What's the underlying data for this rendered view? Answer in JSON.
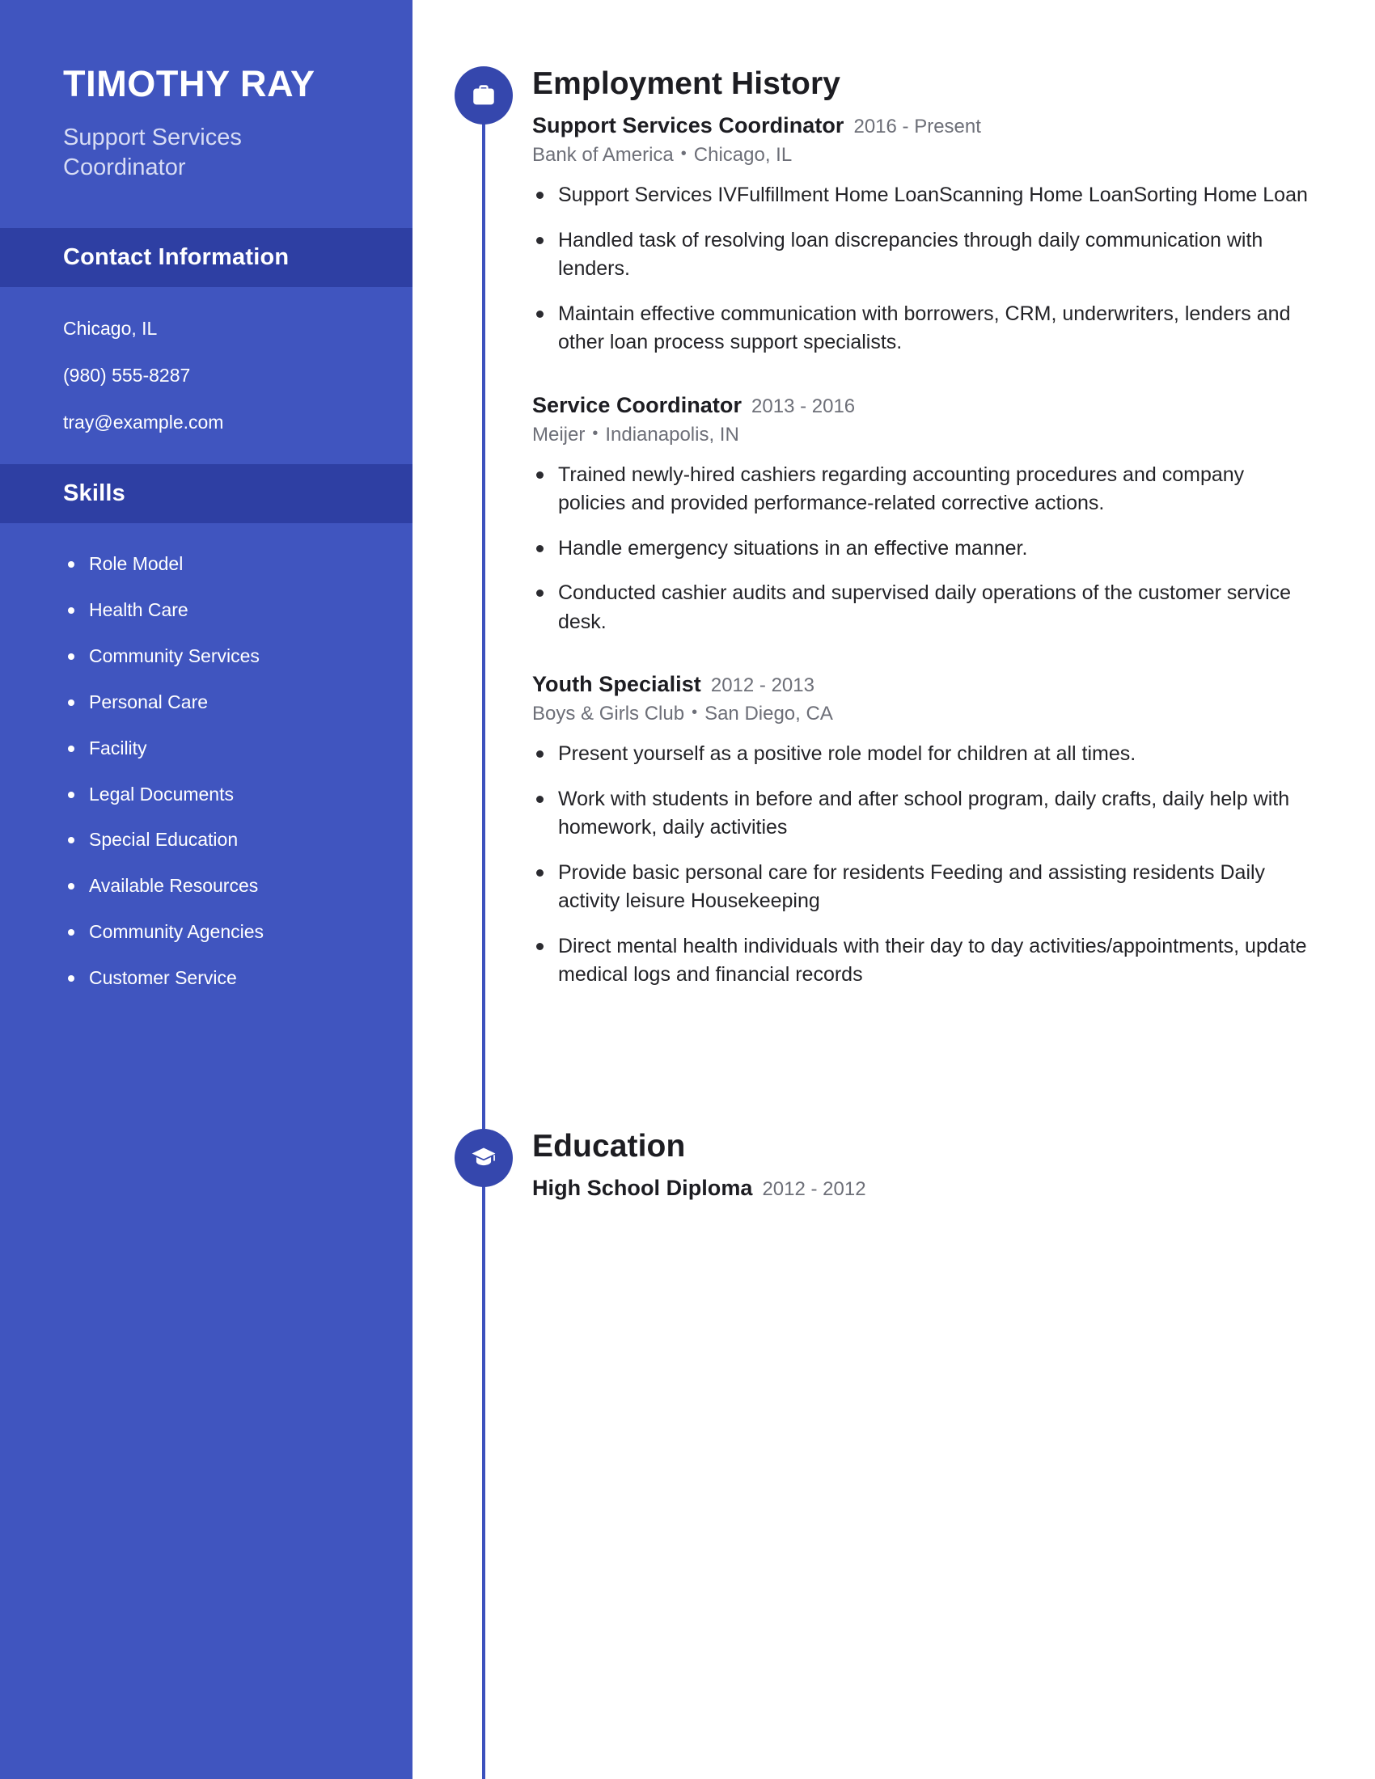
{
  "theme": {
    "sidebar_bg": "#4055bf",
    "sidebar_header_bg": "#2e3fa3",
    "accent": "#3547ad",
    "text_dark": "#1d1d22",
    "text_muted": "#6d6f78"
  },
  "sidebar": {
    "name": "TIMOTHY RAY",
    "headline": "Support Services Coordinator",
    "sections": [
      {
        "id": "contact",
        "title": "Contact Information",
        "items": [
          "Chicago, IL",
          "(980) 555-8287",
          "tray@example.com"
        ]
      },
      {
        "id": "skills",
        "title": "Skills",
        "items": [
          "Role Model",
          "Health Care",
          "Community Services",
          "Personal Care",
          "Facility",
          "Legal Documents",
          "Special Education",
          "Available Resources",
          "Community Agencies",
          "Customer Service"
        ]
      }
    ]
  },
  "main": {
    "employment": {
      "title": "Employment History",
      "icon": "briefcase-icon",
      "entries": [
        {
          "role": "Support Services Coordinator",
          "dates": "2016 - Present",
          "company": "Bank of America",
          "location": "Chicago, IL",
          "bullets": [
            "Support Services IVFulfillment Home LoanScanning Home LoanSorting Home Loan",
            "Handled task of resolving loan discrepancies through daily communication with lenders.",
            "Maintain effective communication with borrowers, CRM, underwriters, lenders and other loan process support specialists."
          ]
        },
        {
          "role": "Service Coordinator",
          "dates": "2013 - 2016",
          "company": "Meijer",
          "location": "Indianapolis, IN",
          "bullets": [
            "Trained newly-hired cashiers regarding accounting procedures and company policies and provided performance-related corrective actions.",
            "Handle emergency situations in an effective manner.",
            "Conducted cashier audits and supervised daily operations of the customer service desk."
          ]
        },
        {
          "role": "Youth Specialist",
          "dates": "2012 - 2013",
          "company": "Boys & Girls Club",
          "location": "San Diego, CA",
          "bullets": [
            "Present yourself as a positive role model for children at all times.",
            "Work with students in before and after school program, daily crafts, daily help with homework, daily activities",
            "Provide basic personal care for residents Feeding and assisting residents Daily activity leisure Housekeeping",
            "Direct mental health individuals with their day to day activities/appointments, update medical logs and financial records"
          ]
        }
      ]
    },
    "education": {
      "title": "Education",
      "icon": "graduation-cap-icon",
      "entries": [
        {
          "role": "High School Diploma",
          "dates": "2012 - 2012"
        }
      ]
    }
  },
  "separator": "•"
}
